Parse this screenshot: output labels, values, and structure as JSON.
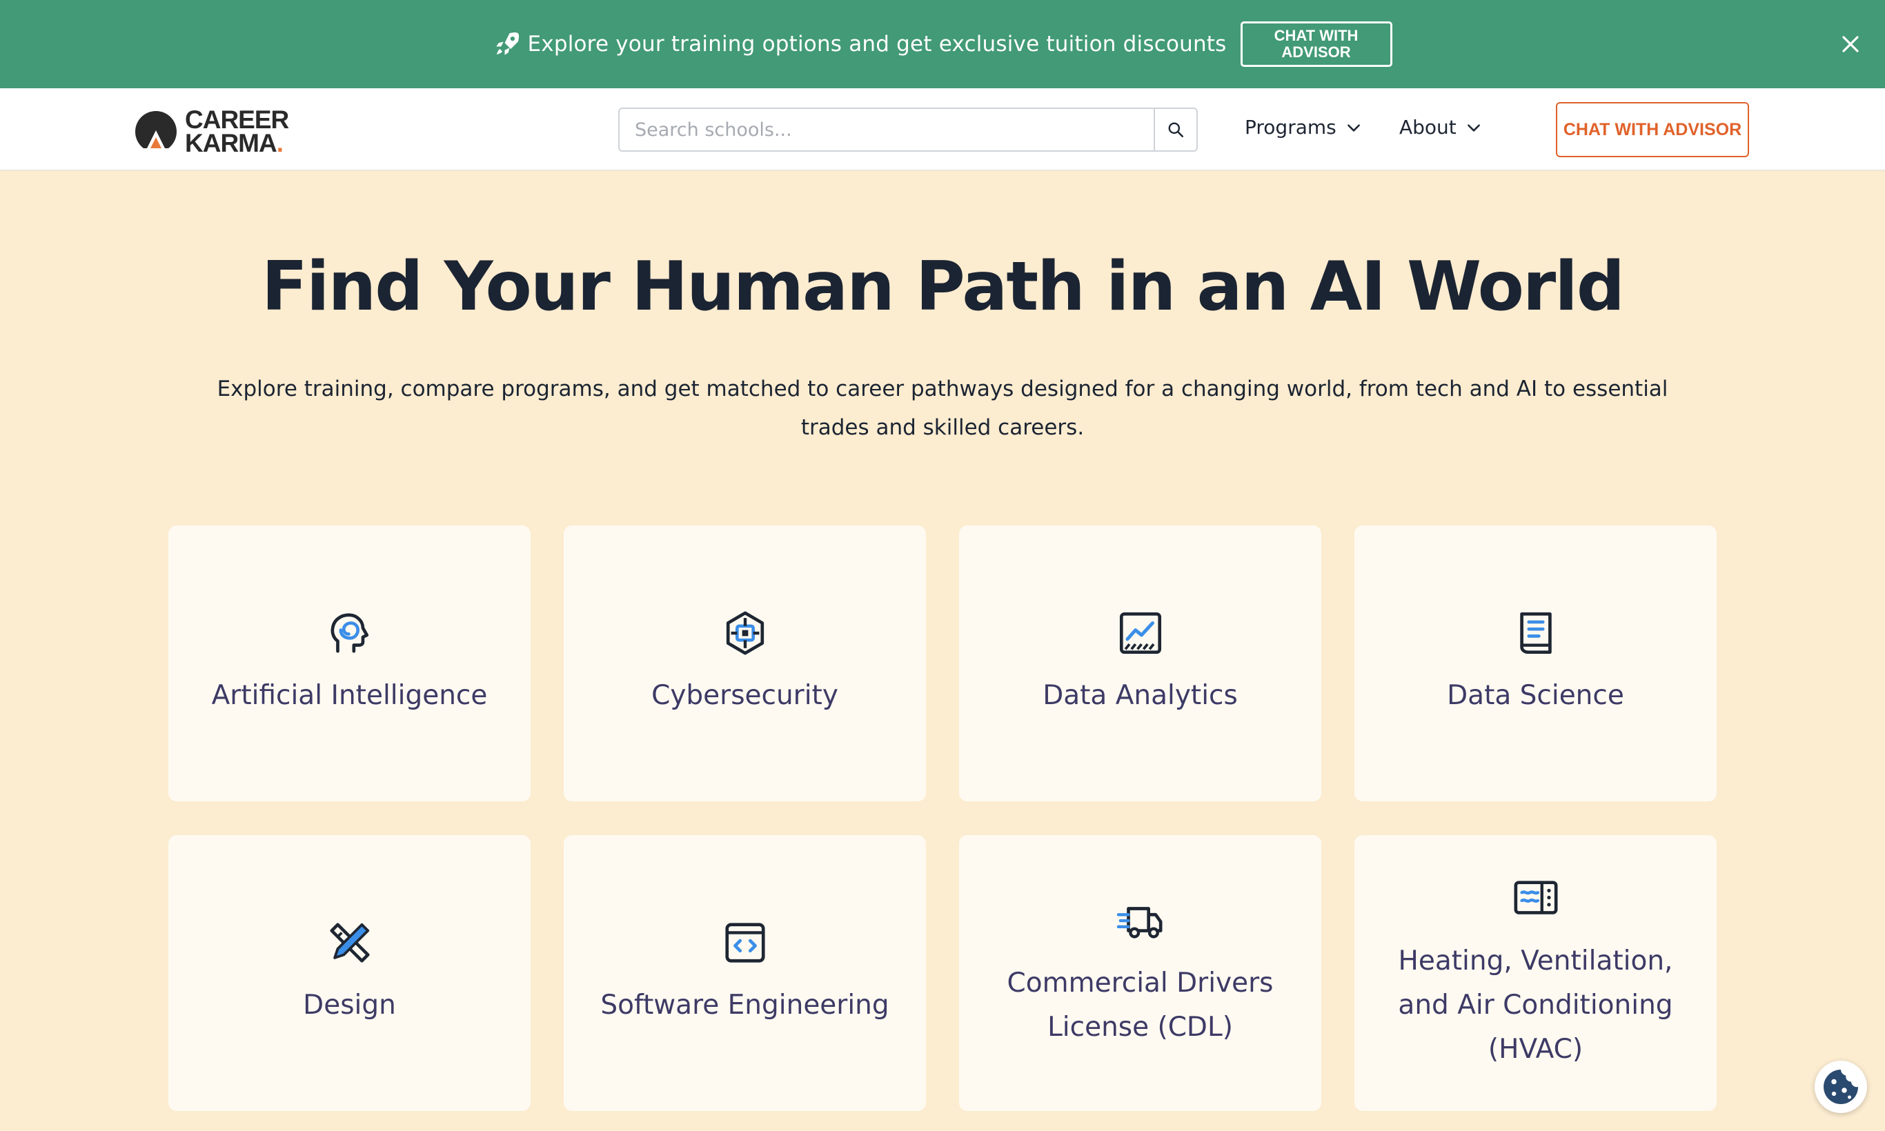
{
  "banner": {
    "text": "Explore your training options and get exclusive tuition discounts",
    "button_label": "CHAT WITH ADVISOR",
    "icon": "rocket-icon",
    "close_icon": "close-icon"
  },
  "navbar": {
    "logo": {
      "line1": "CAREER",
      "line2": "KARMA",
      "dot": "."
    },
    "search": {
      "placeholder": "Search schools...",
      "value": ""
    },
    "programs_label": "Programs",
    "about_label": "About",
    "cta_label": "CHAT WITH ADVISOR"
  },
  "hero": {
    "title_main": "Find Your Human Path in an ",
    "title_highlight": "AI World",
    "subtitle": "Explore training, compare programs, and get matched to career pathways designed for a changing world, from tech and AI to essential trades and skilled careers."
  },
  "categories": [
    {
      "label": "Artificial Intelligence",
      "icon": "ai-head-icon"
    },
    {
      "label": "Cybersecurity",
      "icon": "shield-chip-icon"
    },
    {
      "label": "Data Analytics",
      "icon": "chart-icon"
    },
    {
      "label": "Data Science",
      "icon": "notebook-icon"
    },
    {
      "label": "Design",
      "icon": "pencil-ruler-icon"
    },
    {
      "label": "Software Engineering",
      "icon": "code-window-icon"
    },
    {
      "label": "Commercial Drivers License (CDL)",
      "icon": "truck-icon"
    },
    {
      "label": "Heating, Ventilation, and Air Conditioning (HVAC)",
      "icon": "hvac-unit-icon"
    }
  ],
  "colors": {
    "banner_bg": "#429a76",
    "page_bg": "#fcecd0",
    "accent_orange": "#e0622a",
    "highlight_yellow": "#f7ad12",
    "card_label": "#3d3a66",
    "icon_blue": "#3b8ee8"
  }
}
